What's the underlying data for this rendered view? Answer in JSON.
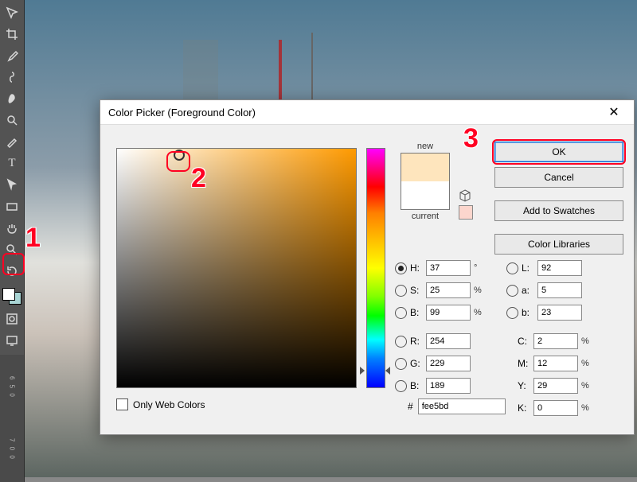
{
  "toolbar": {
    "tools": [
      "move",
      "crop",
      "eyedropper",
      "brush",
      "eraser",
      "blur",
      "pen",
      "type",
      "arrow",
      "rect",
      "hand",
      "zoom",
      "rotate"
    ]
  },
  "ruler": {
    "marks": [
      "6",
      "5",
      "0",
      "7",
      "0",
      "0"
    ]
  },
  "dialog": {
    "title": "Color Picker (Foreground Color)",
    "swatch": {
      "new_label": "new",
      "current_label": "current"
    },
    "buttons": {
      "ok": "OK",
      "cancel": "Cancel",
      "add_swatches": "Add to Swatches",
      "color_libraries": "Color Libraries"
    },
    "channels": {
      "H": {
        "label": "H:",
        "value": "37",
        "unit": "°",
        "radio": true,
        "checked": true
      },
      "S": {
        "label": "S:",
        "value": "25",
        "unit": "%",
        "radio": true
      },
      "Bv": {
        "label": "B:",
        "value": "99",
        "unit": "%",
        "radio": true
      },
      "R": {
        "label": "R:",
        "value": "254",
        "unit": "",
        "radio": true
      },
      "G": {
        "label": "G:",
        "value": "229",
        "unit": "",
        "radio": true
      },
      "B": {
        "label": "B:",
        "value": "189",
        "unit": "",
        "radio": true
      },
      "L": {
        "label": "L:",
        "value": "92",
        "unit": "",
        "radio": true
      },
      "a": {
        "label": "a:",
        "value": "5",
        "unit": "",
        "radio": true
      },
      "b": {
        "label": "b:",
        "value": "23",
        "unit": "",
        "radio": true
      },
      "C": {
        "label": "C:",
        "value": "2",
        "unit": "%",
        "radio": false
      },
      "M": {
        "label": "M:",
        "value": "12",
        "unit": "%",
        "radio": false
      },
      "Y": {
        "label": "Y:",
        "value": "29",
        "unit": "%",
        "radio": false
      },
      "K": {
        "label": "K:",
        "value": "0",
        "unit": "%",
        "radio": false
      }
    },
    "only_web": "Only Web Colors",
    "hex_prefix": "#",
    "hex_value": "fee5bd"
  },
  "annotations": {
    "n1": "1",
    "n2": "2",
    "n3": "3"
  }
}
